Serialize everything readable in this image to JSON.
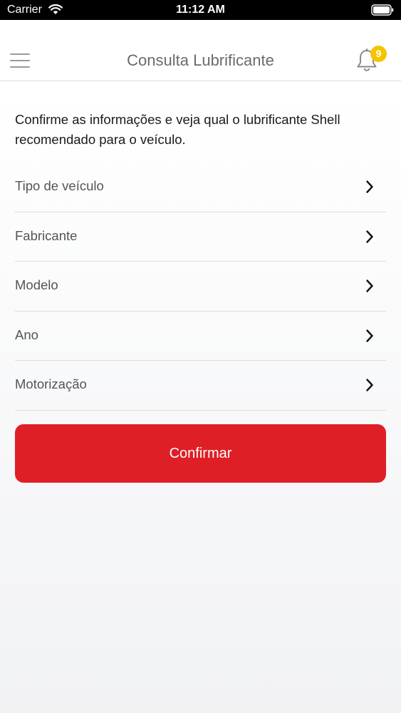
{
  "status_bar": {
    "carrier": "Carrier",
    "time": "11:12 AM"
  },
  "nav": {
    "title": "Consulta Lubrificante",
    "notification_count": "9",
    "badge_color": "#f5c400"
  },
  "intro_text": "Confirme as informações e veja qual o lubrificante Shell recomendado para o veículo.",
  "fields": [
    {
      "label": "Tipo de veículo"
    },
    {
      "label": "Fabricante"
    },
    {
      "label": "Modelo"
    },
    {
      "label": "Ano"
    },
    {
      "label": "Motorização"
    }
  ],
  "confirm_button": {
    "label": "Confirmar",
    "color": "#df1f26"
  },
  "icons": [
    "wifi-icon",
    "battery-icon",
    "hamburger-menu-icon",
    "bell-icon",
    "chevron-right-icon"
  ]
}
